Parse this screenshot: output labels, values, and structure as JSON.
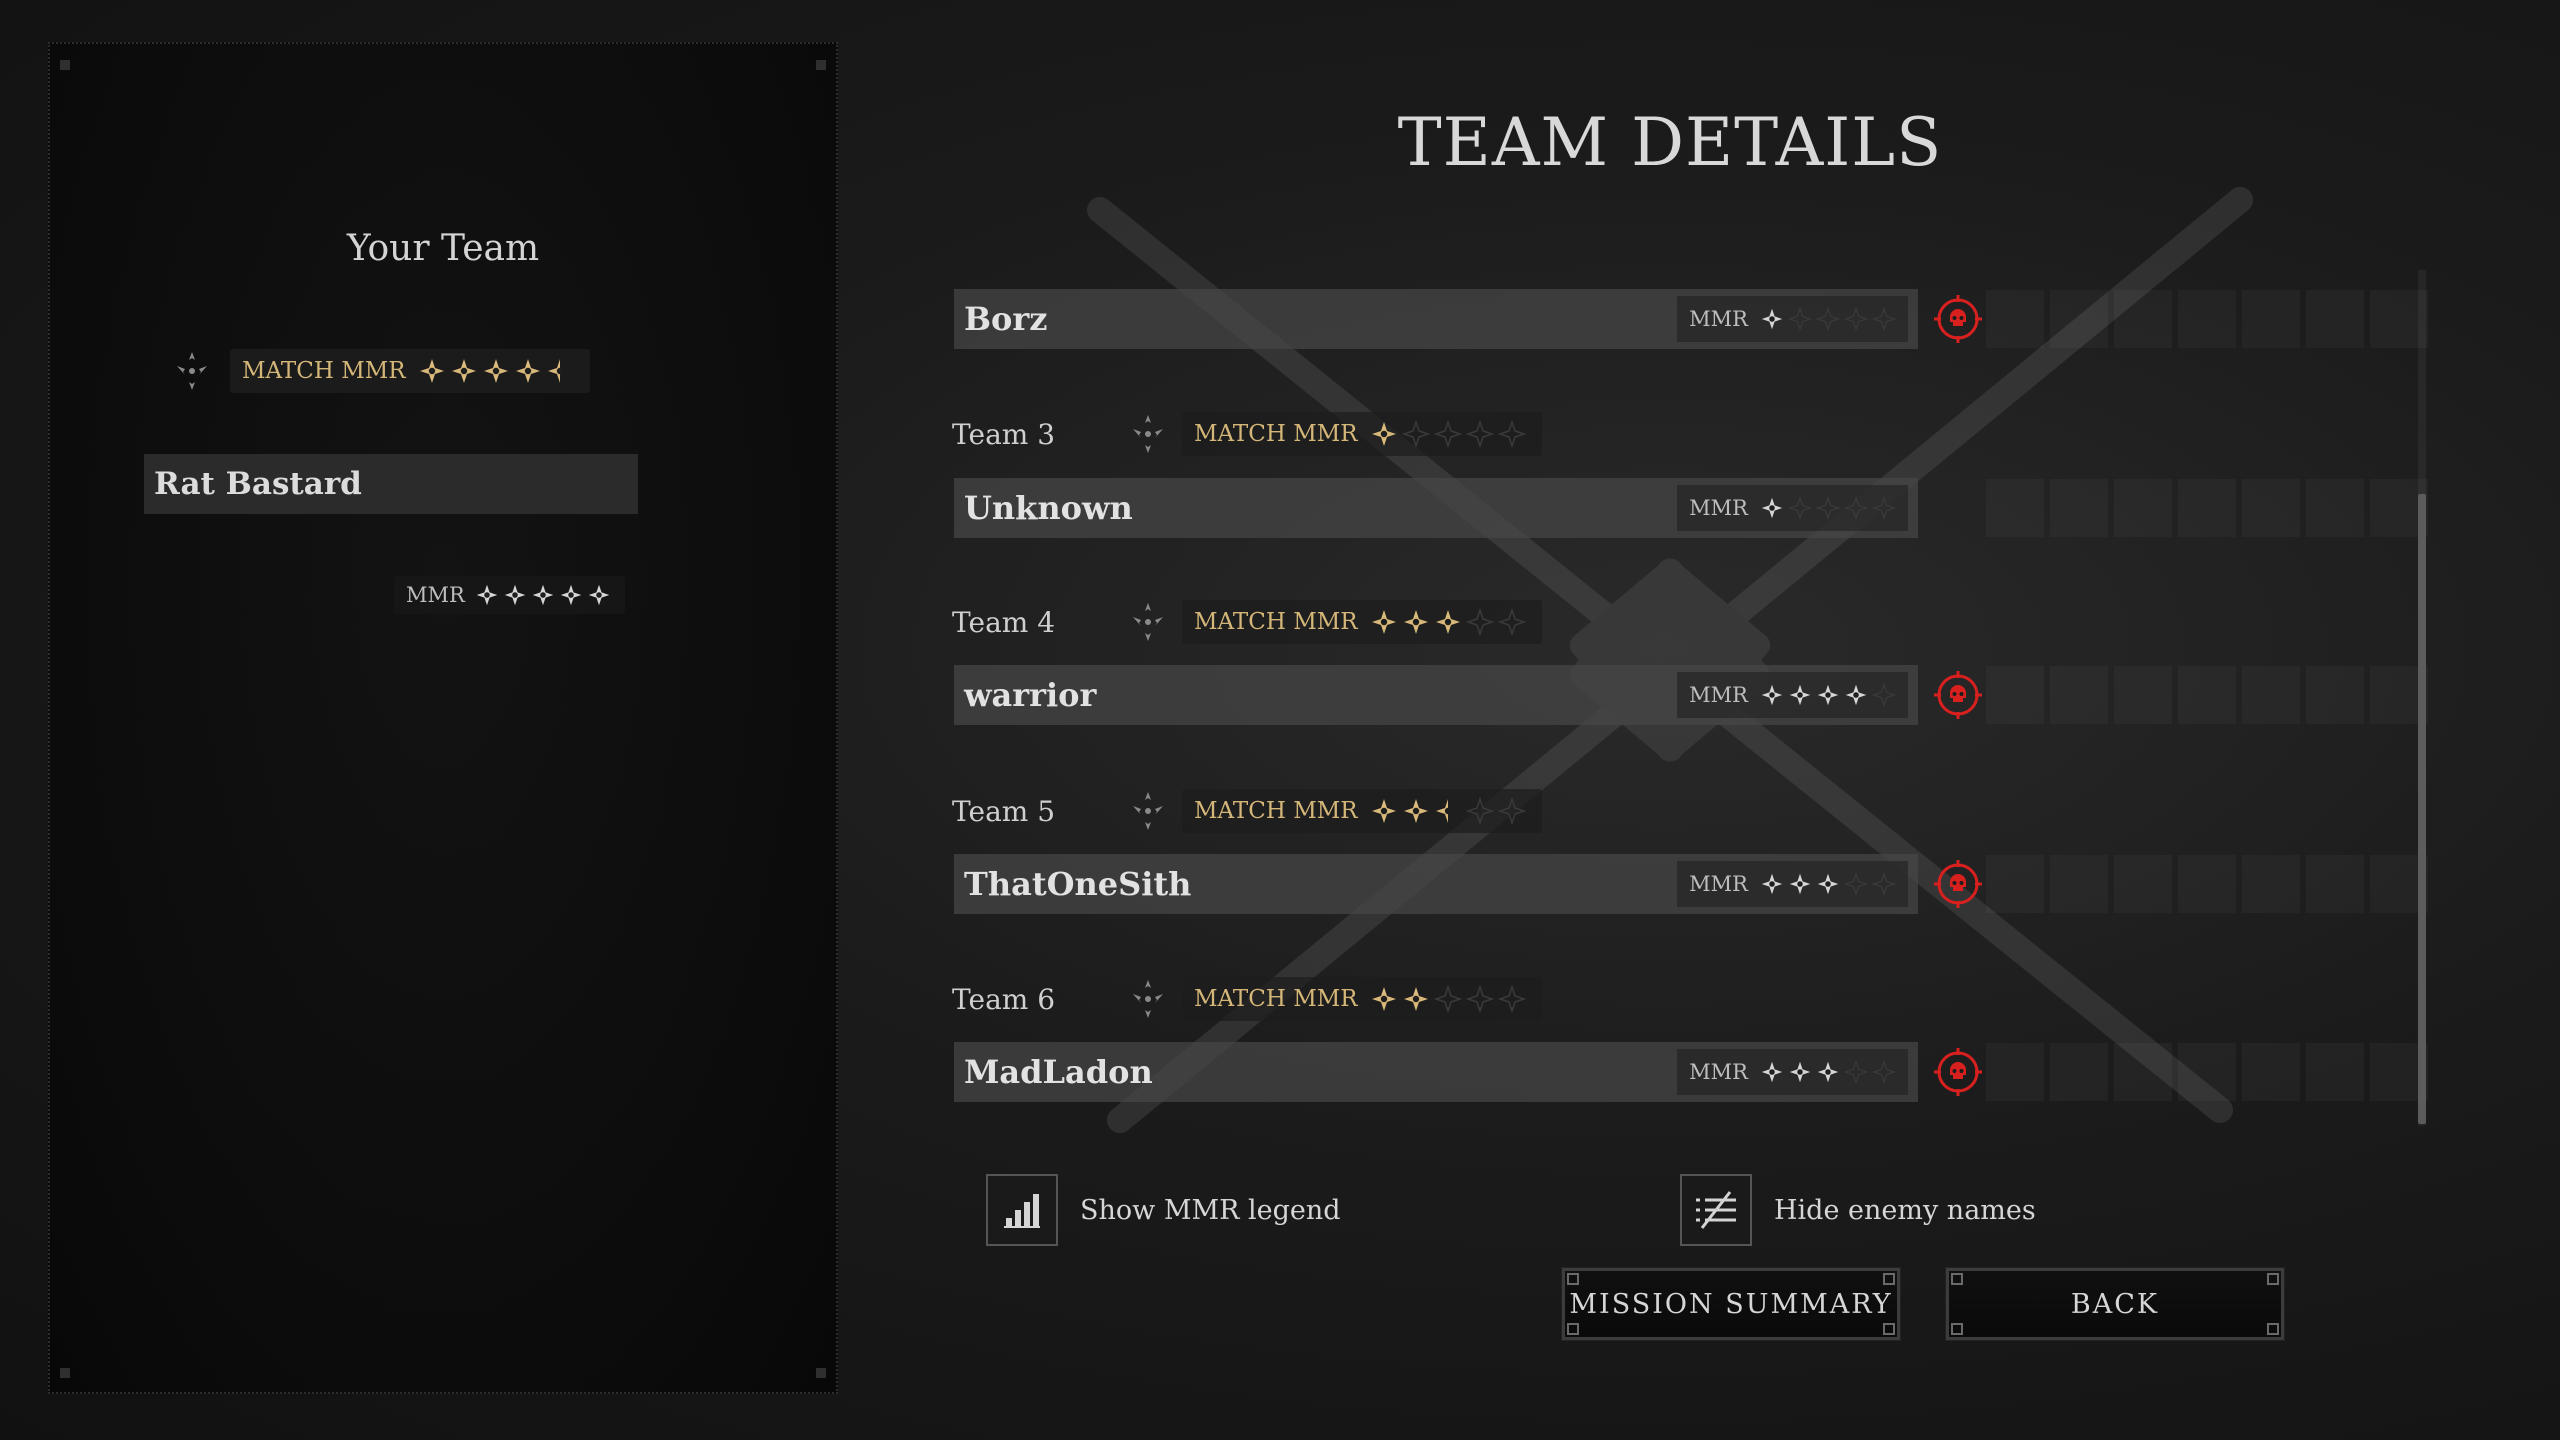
{
  "title": "TEAM DETAILS",
  "your_team": {
    "title": "Your Team",
    "match_mmr_label": "MATCH MMR",
    "match_mmr_stars": 4.5,
    "player": {
      "name": "Rat Bastard",
      "mmr_label": "MMR",
      "mmr_stars": 5
    }
  },
  "teams": [
    {
      "label": "",
      "player": "Borz",
      "mmr_label": "MMR",
      "mmr_stars": 1,
      "killed": true
    },
    {
      "label": "Team 3",
      "match_mmr_label": "MATCH MMR",
      "match_mmr_stars": 1,
      "player": "Unknown",
      "mmr_label": "MMR",
      "mmr_stars": 1,
      "killed": false
    },
    {
      "label": "Team 4",
      "match_mmr_label": "MATCH MMR",
      "match_mmr_stars": 3,
      "player": "warrior",
      "mmr_label": "MMR",
      "mmr_stars": 4,
      "killed": true
    },
    {
      "label": "Team 5",
      "match_mmr_label": "MATCH MMR",
      "match_mmr_stars": 2.5,
      "player": "ThatOneSith",
      "mmr_label": "MMR",
      "mmr_stars": 3,
      "killed": true
    },
    {
      "label": "Team 6",
      "match_mmr_label": "MATCH MMR",
      "match_mmr_stars": 2,
      "player": "MadLadon",
      "mmr_label": "MMR",
      "mmr_stars": 3,
      "killed": true
    }
  ],
  "options": {
    "show_mmr_legend": "Show MMR legend",
    "hide_enemy_names": "Hide enemy names"
  },
  "buttons": {
    "mission_summary": "MISSION SUMMARY",
    "back": "BACK"
  },
  "colors": {
    "gold": "#d9ba7a",
    "white_star": "#d6d6d6",
    "skull_red": "#d8201f",
    "empty_star": "#3a3a3a"
  },
  "icons": {
    "team": "team-icon",
    "skull": "skull-kill-icon",
    "legend": "bar-chart-icon",
    "hide_names": "list-hide-icon"
  }
}
